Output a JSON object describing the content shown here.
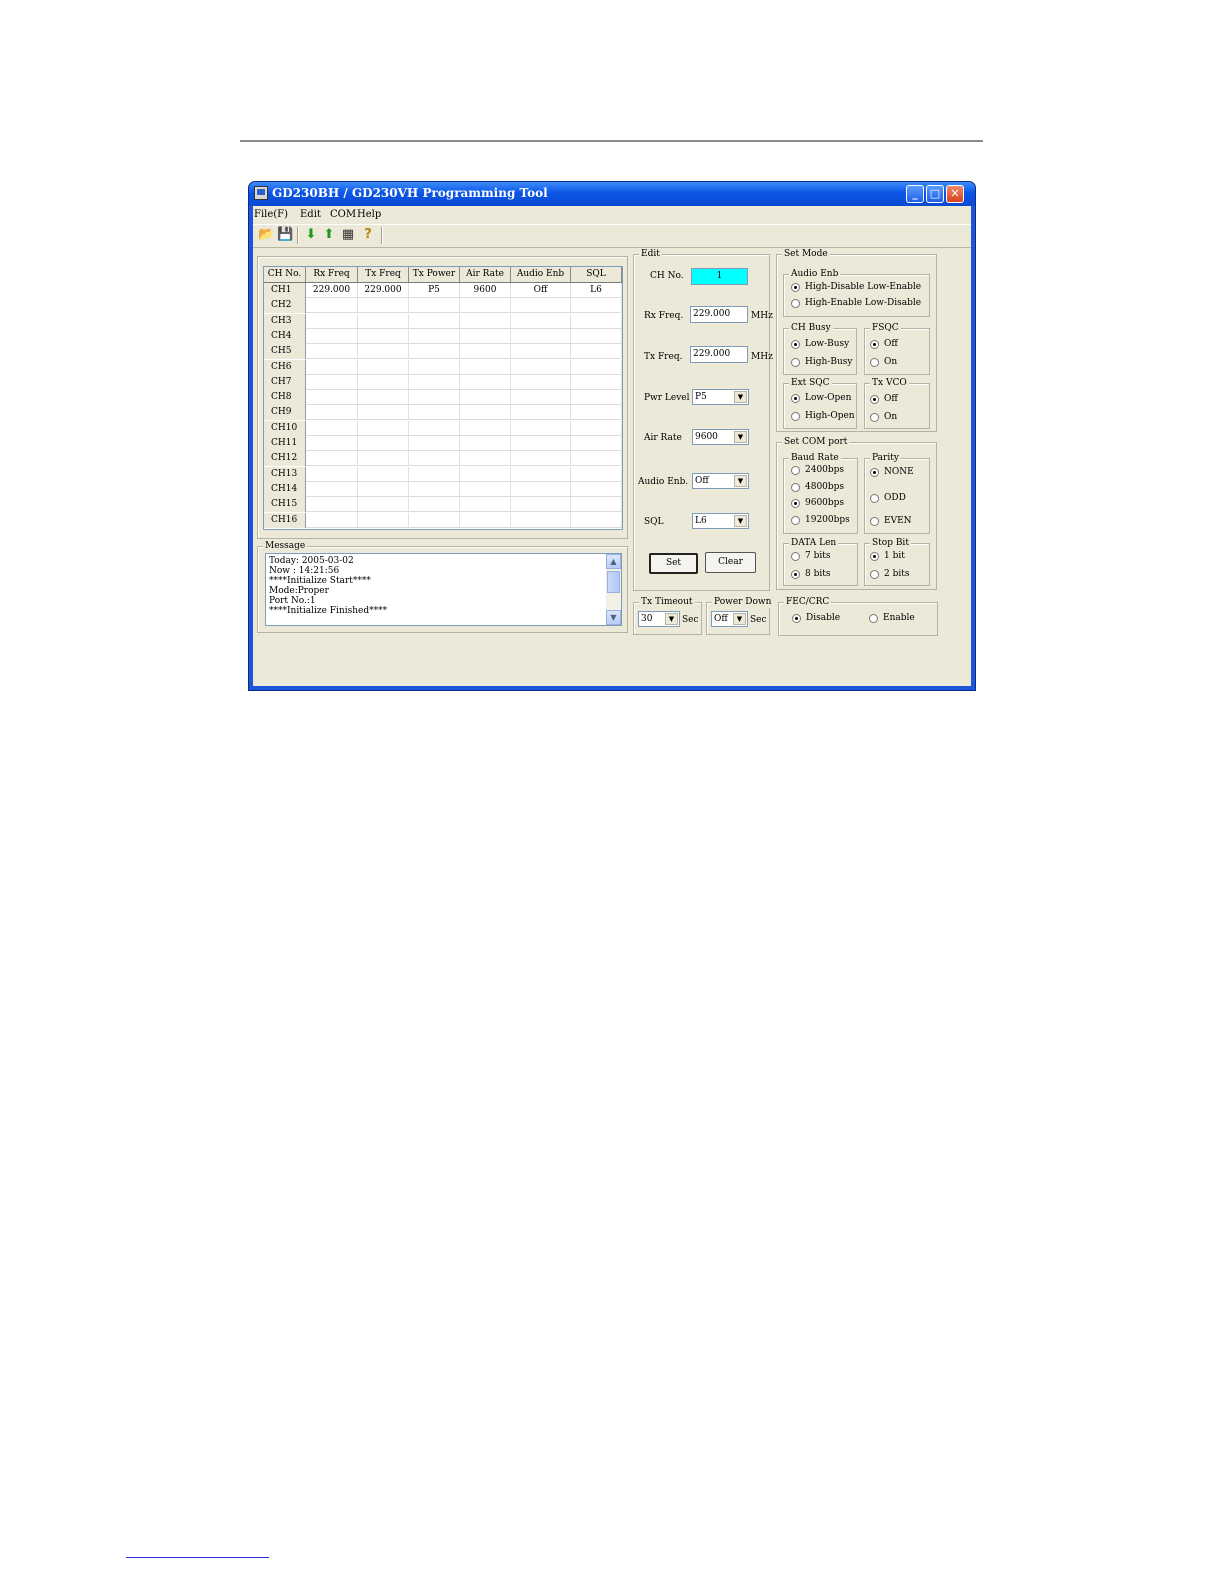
{
  "window": {
    "title": "GD230BH / GD230VH Programming Tool"
  },
  "titlebar_buttons": {
    "minimize": "_",
    "maximize": "□",
    "close": "✕"
  },
  "menu": [
    "File(F)",
    "Edit",
    "COM",
    "Help"
  ],
  "toolbar": {
    "tools": [
      {
        "name": "open-folder-icon",
        "glyph": "📂"
      },
      {
        "name": "save-icon",
        "glyph": "💾"
      },
      {
        "name": "download-arrow-icon",
        "glyph": "⬇"
      },
      {
        "name": "upload-arrow-icon",
        "glyph": "⬆"
      },
      {
        "name": "chip-icon",
        "glyph": "▦"
      },
      {
        "name": "help-icon",
        "glyph": "?"
      }
    ]
  },
  "channel_table": {
    "columns": [
      "CH No.",
      "Rx Freq",
      "Tx Freq",
      "Tx Power",
      "Air Rate",
      "Audio Enb",
      "SQL"
    ],
    "rows": [
      [
        "CH1",
        "229.000",
        "229.000",
        "P5",
        "9600",
        "Off",
        "L6"
      ],
      [
        "CH2",
        "",
        "",
        "",
        "",
        "",
        ""
      ],
      [
        "CH3",
        "",
        "",
        "",
        "",
        "",
        ""
      ],
      [
        "CH4",
        "",
        "",
        "",
        "",
        "",
        ""
      ],
      [
        "CH5",
        "",
        "",
        "",
        "",
        "",
        ""
      ],
      [
        "CH6",
        "",
        "",
        "",
        "",
        "",
        ""
      ],
      [
        "CH7",
        "",
        "",
        "",
        "",
        "",
        ""
      ],
      [
        "CH8",
        "",
        "",
        "",
        "",
        "",
        ""
      ],
      [
        "CH9",
        "",
        "",
        "",
        "",
        "",
        ""
      ],
      [
        "CH10",
        "",
        "",
        "",
        "",
        "",
        ""
      ],
      [
        "CH11",
        "",
        "",
        "",
        "",
        "",
        ""
      ],
      [
        "CH12",
        "",
        "",
        "",
        "",
        "",
        ""
      ],
      [
        "CH13",
        "",
        "",
        "",
        "",
        "",
        ""
      ],
      [
        "CH14",
        "",
        "",
        "",
        "",
        "",
        ""
      ],
      [
        "CH15",
        "",
        "",
        "",
        "",
        "",
        ""
      ],
      [
        "CH16",
        "",
        "",
        "",
        "",
        "",
        ""
      ]
    ]
  },
  "message": {
    "label": "Message",
    "lines": [
      "Today: 2005-03-02",
      "Now  : 14:21:56",
      "****Initialize Start****",
      "Mode:Proper",
      "Port No.:1",
      "****Initialize Finished****"
    ]
  },
  "edit": {
    "label": "Edit",
    "ch_no": {
      "label": "CH No.",
      "value": "1"
    },
    "rx_freq": {
      "label": "Rx Freq.",
      "value": "229.000",
      "unit": "MHz"
    },
    "tx_freq": {
      "label": "Tx Freq.",
      "value": "229.000",
      "unit": "MHz"
    },
    "pwr_level": {
      "label": "Pwr Level",
      "value": "P5"
    },
    "air_rate": {
      "label": "Air Rate",
      "value": "9600"
    },
    "audio_enb": {
      "label": "Audio Enb.",
      "value": "Off"
    },
    "sql": {
      "label": "SQL",
      "value": "L6"
    },
    "set_button": "Set",
    "clear_button": "Clear"
  },
  "tx_timeout": {
    "label": "Tx Timeout",
    "value": "30",
    "unit": "Sec"
  },
  "power_down": {
    "label": "Power Down",
    "value": "Off",
    "unit": "Sec"
  },
  "set_mode": {
    "label": "Set Mode",
    "audio_enb": {
      "label": "Audio Enb",
      "options": [
        "High-Disable Low-Enable",
        "High-Enable Low-Disable"
      ],
      "selected": 0
    },
    "ch_busy": {
      "label": "CH Busy",
      "options": [
        "Low-Busy",
        "High-Busy"
      ],
      "selected": 0
    },
    "fsqc": {
      "label": "FSQC",
      "options": [
        "Off",
        "On"
      ],
      "selected": 0
    },
    "ext_sqc": {
      "label": "Ext SQC",
      "options": [
        "Low-Open",
        "High-Open"
      ],
      "selected": 0
    },
    "tx_vco": {
      "label": "Tx VCO",
      "options": [
        "Off",
        "On"
      ],
      "selected": 0
    }
  },
  "set_com_port": {
    "label": "Set COM port",
    "baud_rate": {
      "label": "Baud Rate",
      "options": [
        "2400bps",
        "4800bps",
        "9600bps",
        "19200bps"
      ],
      "selected": 2
    },
    "parity": {
      "label": "Parity",
      "options": [
        "NONE",
        "ODD",
        "EVEN"
      ],
      "selected": 0
    },
    "data_len": {
      "label": "DATA Len",
      "options": [
        "7 bits",
        "8 bits"
      ],
      "selected": 1
    },
    "stop_bit": {
      "label": "Stop Bit",
      "options": [
        "1 bit",
        "2 bits"
      ],
      "selected": 0
    }
  },
  "fec_crc": {
    "label": "FEC/CRC",
    "options": [
      "Disable",
      "Enable"
    ],
    "selected": 0
  }
}
